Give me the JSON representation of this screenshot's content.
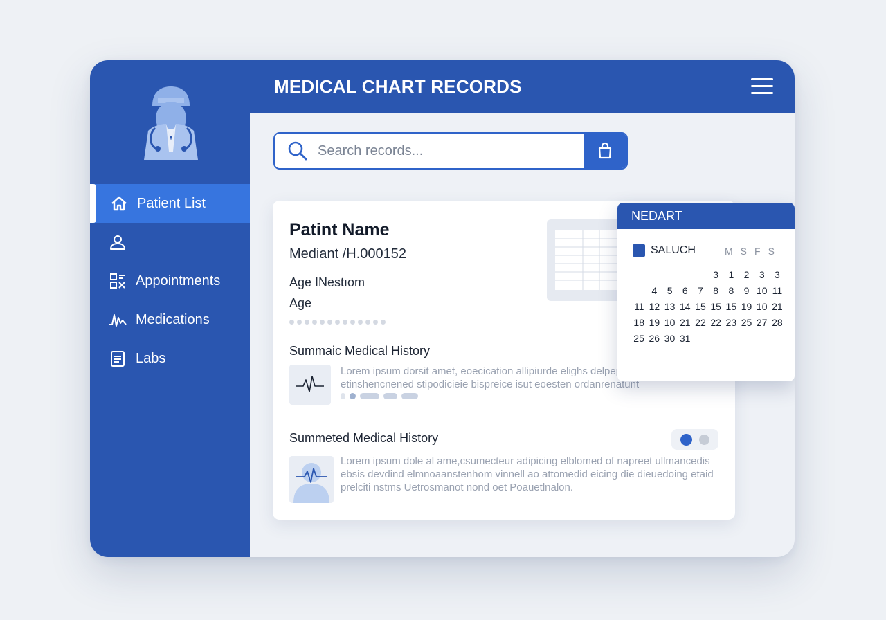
{
  "app": {
    "title": "MEDICAL CHART RECORDS"
  },
  "sidebar": {
    "items": [
      {
        "label": "Patient List",
        "icon": "home-icon",
        "active": true
      },
      {
        "label": "",
        "icon": "user-icon",
        "active": false
      },
      {
        "label": "Appointments",
        "icon": "calendar-grid-icon",
        "active": false
      },
      {
        "label": "Medications",
        "icon": "pulse-icon",
        "active": false
      },
      {
        "label": "Labs",
        "icon": "clipboard-icon",
        "active": false
      }
    ]
  },
  "search": {
    "placeholder": "Search records..."
  },
  "patient": {
    "name": "Patint Name",
    "id": "Mediant /H.000152",
    "age_label": "Age INestıom",
    "age_value": "Age"
  },
  "history": [
    {
      "title": "Summaic Medical History",
      "text": "Lorem ipsum dorsit amet, eoecication allipiurde elighs delpepo erous inmodnt etinshencnened stipodicieie bispreice isut eoesten ordanrenatunt"
    },
    {
      "title": "Summeted Medical History",
      "text": "Lorem ipsum dole al ame,csumecteur adipicing elblomed of napreet ullmancedis ebsis devdind elmnoaanstenhom vinnell ao attomedid eicing die dieuedoing etaid prelciti nstms Uetrosmanot nond oet Poauetlnalon."
    }
  ],
  "calendar": {
    "header": "NEDART",
    "subtitle": "SALUCH",
    "weekdays": [
      "M",
      "S",
      "F",
      "S"
    ],
    "weeks": [
      [
        "3",
        "1",
        "2",
        "3",
        "3"
      ],
      [
        "4",
        "5",
        "6",
        "7",
        "8",
        "8",
        "9",
        "10",
        "11"
      ],
      [
        "11",
        "12",
        "13",
        "14",
        "15",
        "15",
        "15",
        "19",
        "10",
        "21"
      ],
      [
        "18",
        "19",
        "10",
        "21",
        "22",
        "22",
        "23",
        "25",
        "27",
        "28"
      ],
      [
        "25",
        "26",
        "30",
        "31"
      ]
    ]
  },
  "colors": {
    "primary": "#2a56b0",
    "active": "#3775df",
    "accent": "#2f63c9"
  }
}
